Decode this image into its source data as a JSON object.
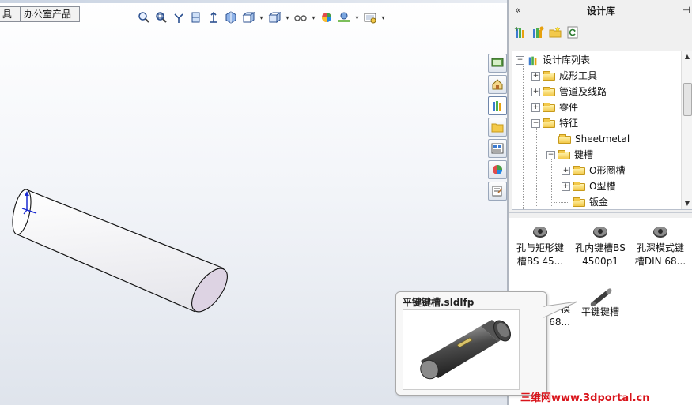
{
  "command_tabs": {
    "tools_label": "具",
    "office_label": "办公室产品"
  },
  "heads_up_toolbar": {
    "icons": [
      "zoom-to-fit-icon",
      "zoom-area-icon",
      "previous-view-icon",
      "section-view-icon",
      "view-orientation-icon",
      "display-style-icon",
      "hide-show-icon",
      "edit-appearance-icon",
      "apply-scene-icon",
      "view-settings-icon"
    ]
  },
  "taskpane": {
    "title": "设计库",
    "collapse_glyph": "«",
    "pin_glyph": "⊣",
    "toolbar_icons": [
      "add-to-library-icon",
      "add-file-location-icon",
      "create-new-folder-icon",
      "refresh-icon"
    ],
    "tab_icons": [
      "solidworks-resources-icon",
      "design-library-icon",
      "file-explorer-icon",
      "view-palette-icon",
      "appearances-icon",
      "custom-properties-icon"
    ],
    "tree": {
      "root": "设计库列表",
      "items": [
        {
          "label": "成形工具",
          "expander": "+"
        },
        {
          "label": "管道及线路",
          "expander": "+"
        },
        {
          "label": "零件",
          "expander": "+"
        },
        {
          "label": "特征",
          "expander": "−"
        },
        {
          "label": "Sheetmetal",
          "expander": ""
        },
        {
          "label": "键槽",
          "expander": "−"
        },
        {
          "label": "O形圈槽",
          "expander": "+"
        },
        {
          "label": "O型槽",
          "expander": "+"
        },
        {
          "label": "钣金",
          "expander": ""
        }
      ]
    },
    "items": [
      {
        "line1": "孔与矩形键",
        "line2": "槽BS 45..."
      },
      {
        "line1": "孔内键槽BS",
        "line2": "4500p1"
      },
      {
        "line1": "孔深模式键",
        "line2": "槽DIN 68..."
      },
      {
        "line1": "模",
        "line2": "68..."
      },
      {
        "line1": "平键键槽",
        "line2": ""
      }
    ]
  },
  "tooltip": {
    "title": "平键键槽.sldlfp"
  },
  "watermark": "三维网www.3dportal.cn",
  "colors": {
    "accent": "#2a4f8f",
    "watermark": "#d9141b",
    "folder": "#f3c94a"
  }
}
